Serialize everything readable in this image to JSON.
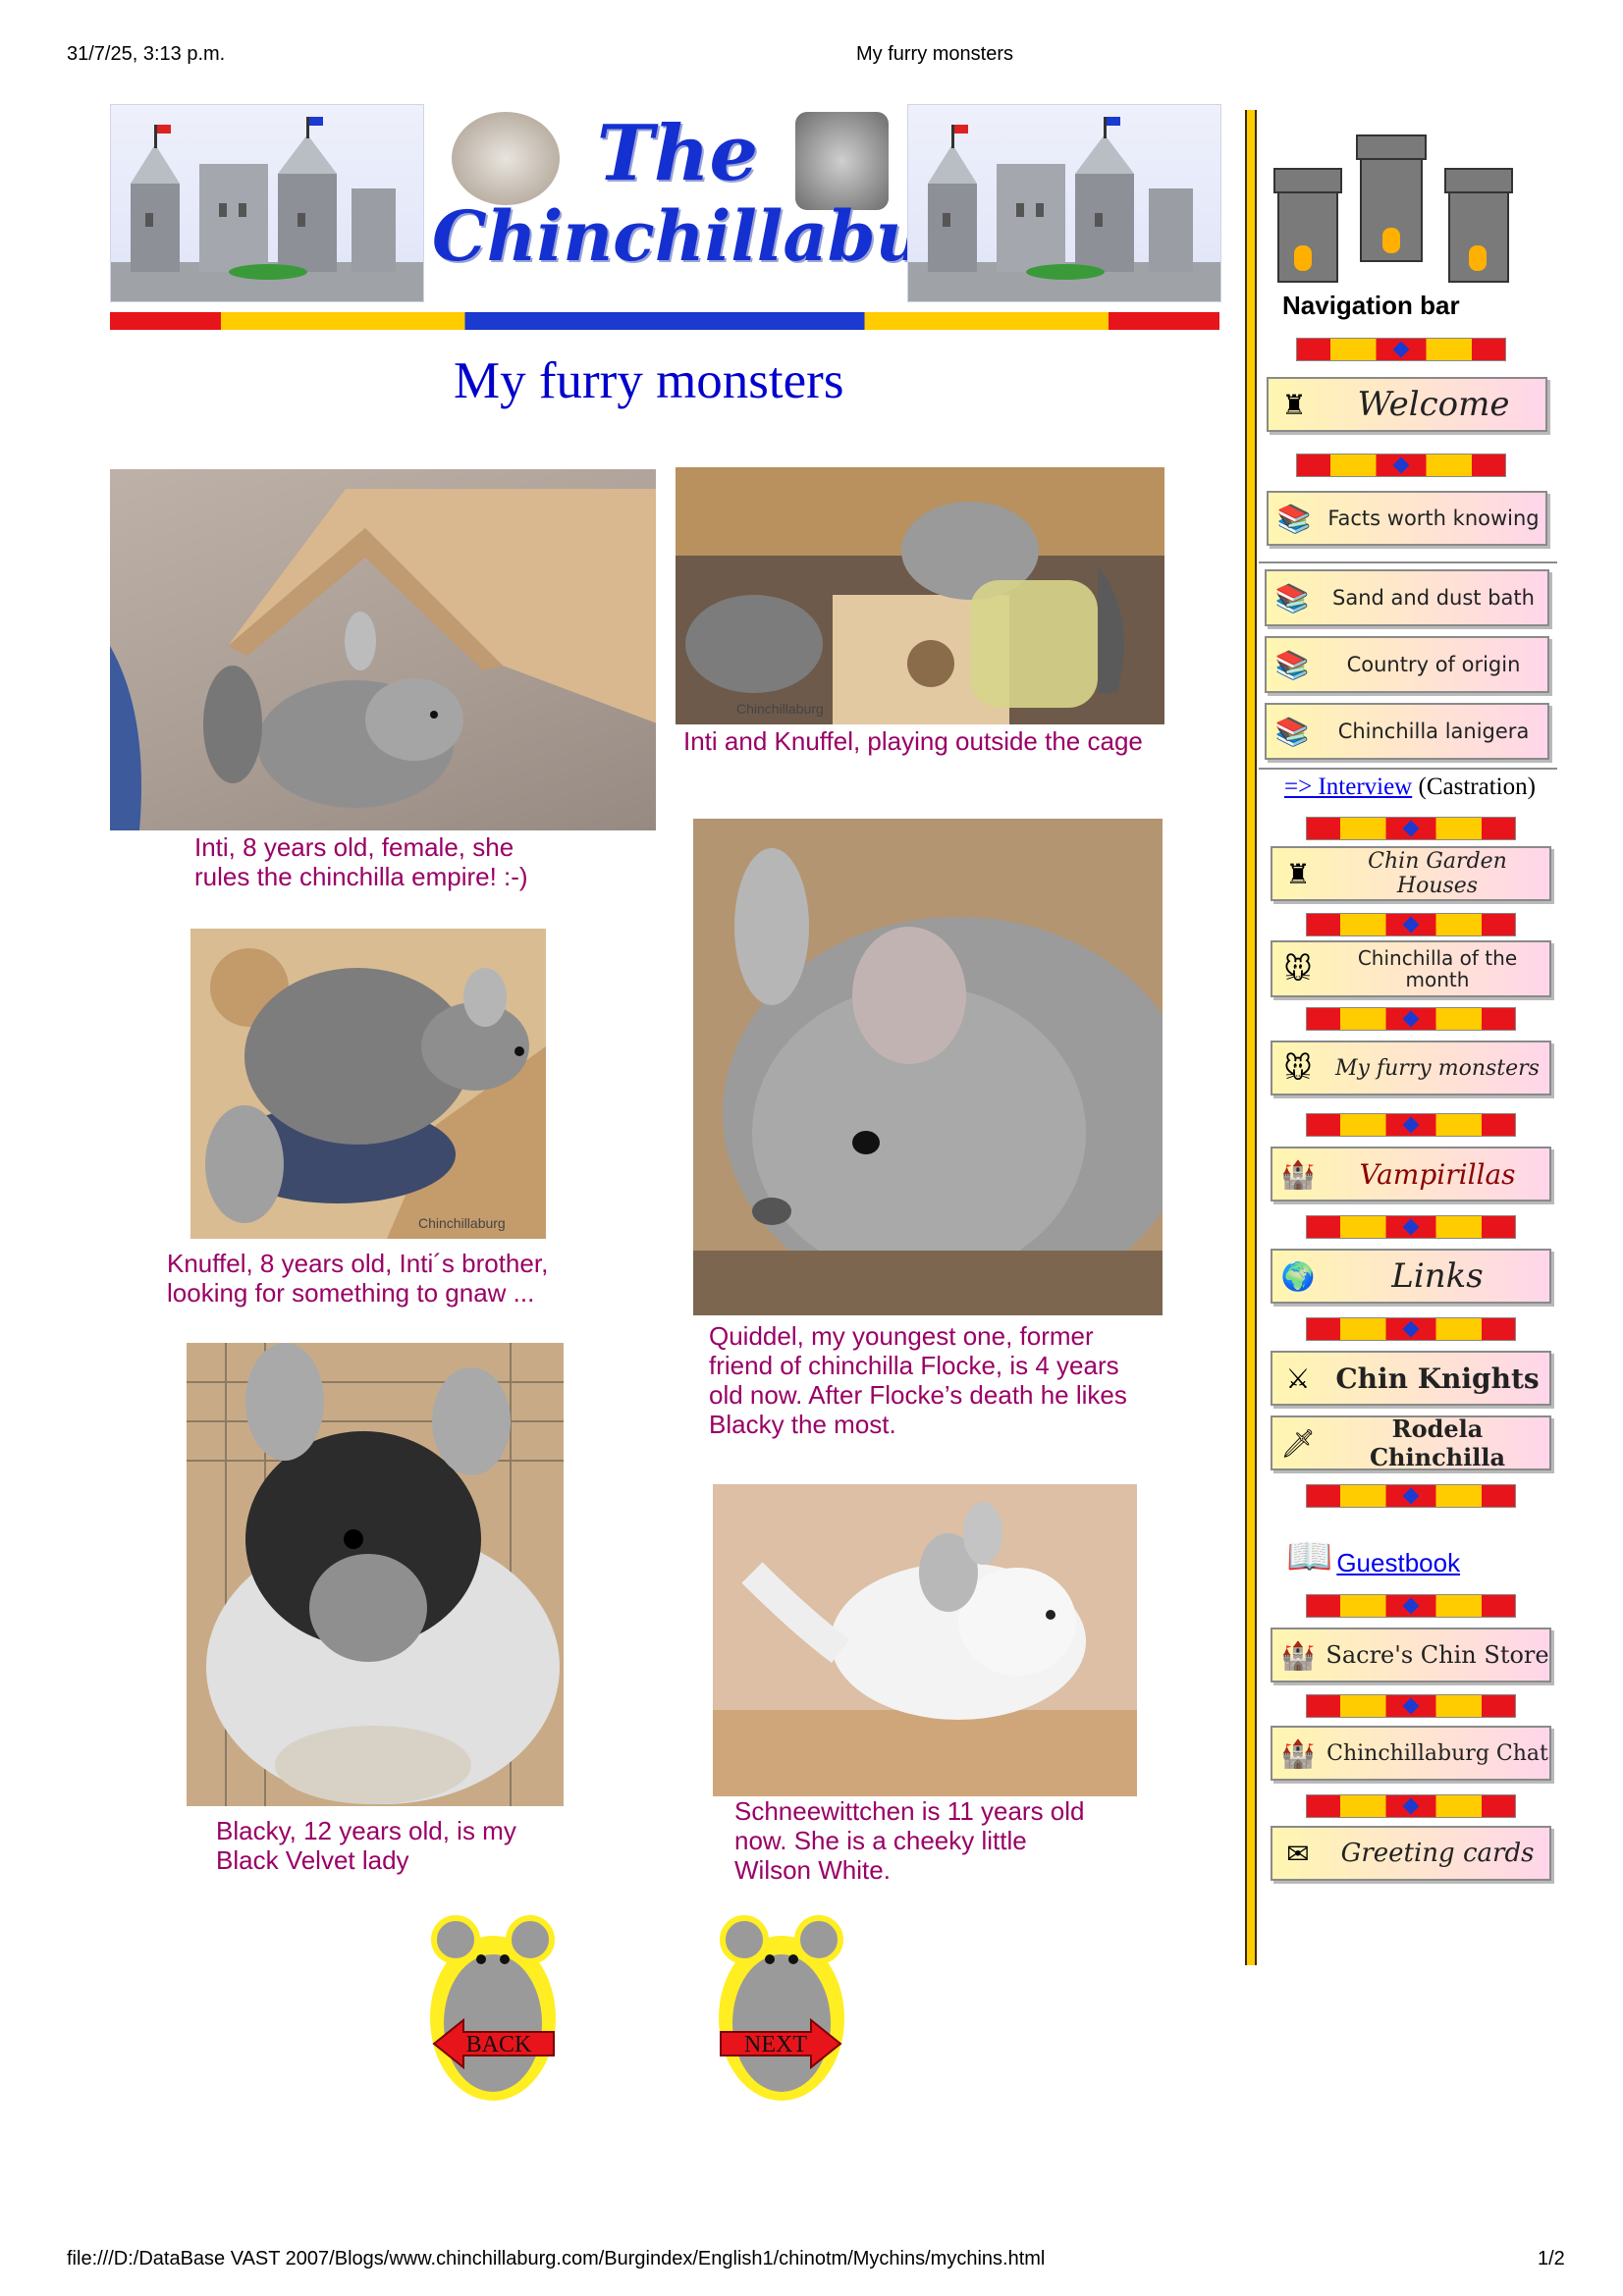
{
  "print_header": {
    "datetime": "31/7/25, 3:13 p.m.",
    "title": "My furry monsters"
  },
  "print_footer": {
    "url": "file:///D:/DataBase VAST 2007/Blogs/www.chinchillaburg.com/Burgindex/English1/chinotm/Mychins/mychins.html",
    "page": "1/2"
  },
  "banner": {
    "line1": "The",
    "line2": "Chinchillaburg"
  },
  "page_title": "My furry monsters",
  "photos": [
    {
      "caption": "Inti, 8 years old, female, she rules the chinchilla empire! :-)"
    },
    {
      "caption": "Inti and Knuffel, playing outside the cage",
      "watermark": "Chinchillaburg"
    },
    {
      "caption": "Knuffel, 8 years old, Inti´s brother, looking for something to gnaw ...",
      "watermark": "Chinchillaburg"
    },
    {
      "caption": "Quiddel, my youngest one, former friend of chinchilla Flocke, is 4 years old now. After Flocke’s death he likes Blacky the most."
    },
    {
      "caption": "Blacky, 12 years old, is my Black Velvet lady"
    },
    {
      "caption": "Schneewittchen is 11 years old now. She is a cheeky little Wilson White."
    }
  ],
  "pager": {
    "back": "BACK",
    "next": "NEXT"
  },
  "nav": {
    "title": "Navigation bar",
    "welcome": "Welcome",
    "facts": "Facts worth knowing",
    "sand": "Sand and dust bath",
    "country": "Country of origin",
    "lanigera": "Chinchilla lanigera",
    "interview_link": "=> Interview",
    "interview_note": "(Castration)",
    "garden": "Chin Garden Houses",
    "month": "Chinchilla of the month",
    "monsters": "My furry monsters",
    "vampirillas": "Vampirillas",
    "links": "Links",
    "knights": "Chin Knights",
    "rodela": "Rodela Chinchilla",
    "guestbook": "Guestbook",
    "store": "Sacre's Chin Store",
    "chat": "Chinchillaburg Chat",
    "cards": "Greeting cards"
  }
}
